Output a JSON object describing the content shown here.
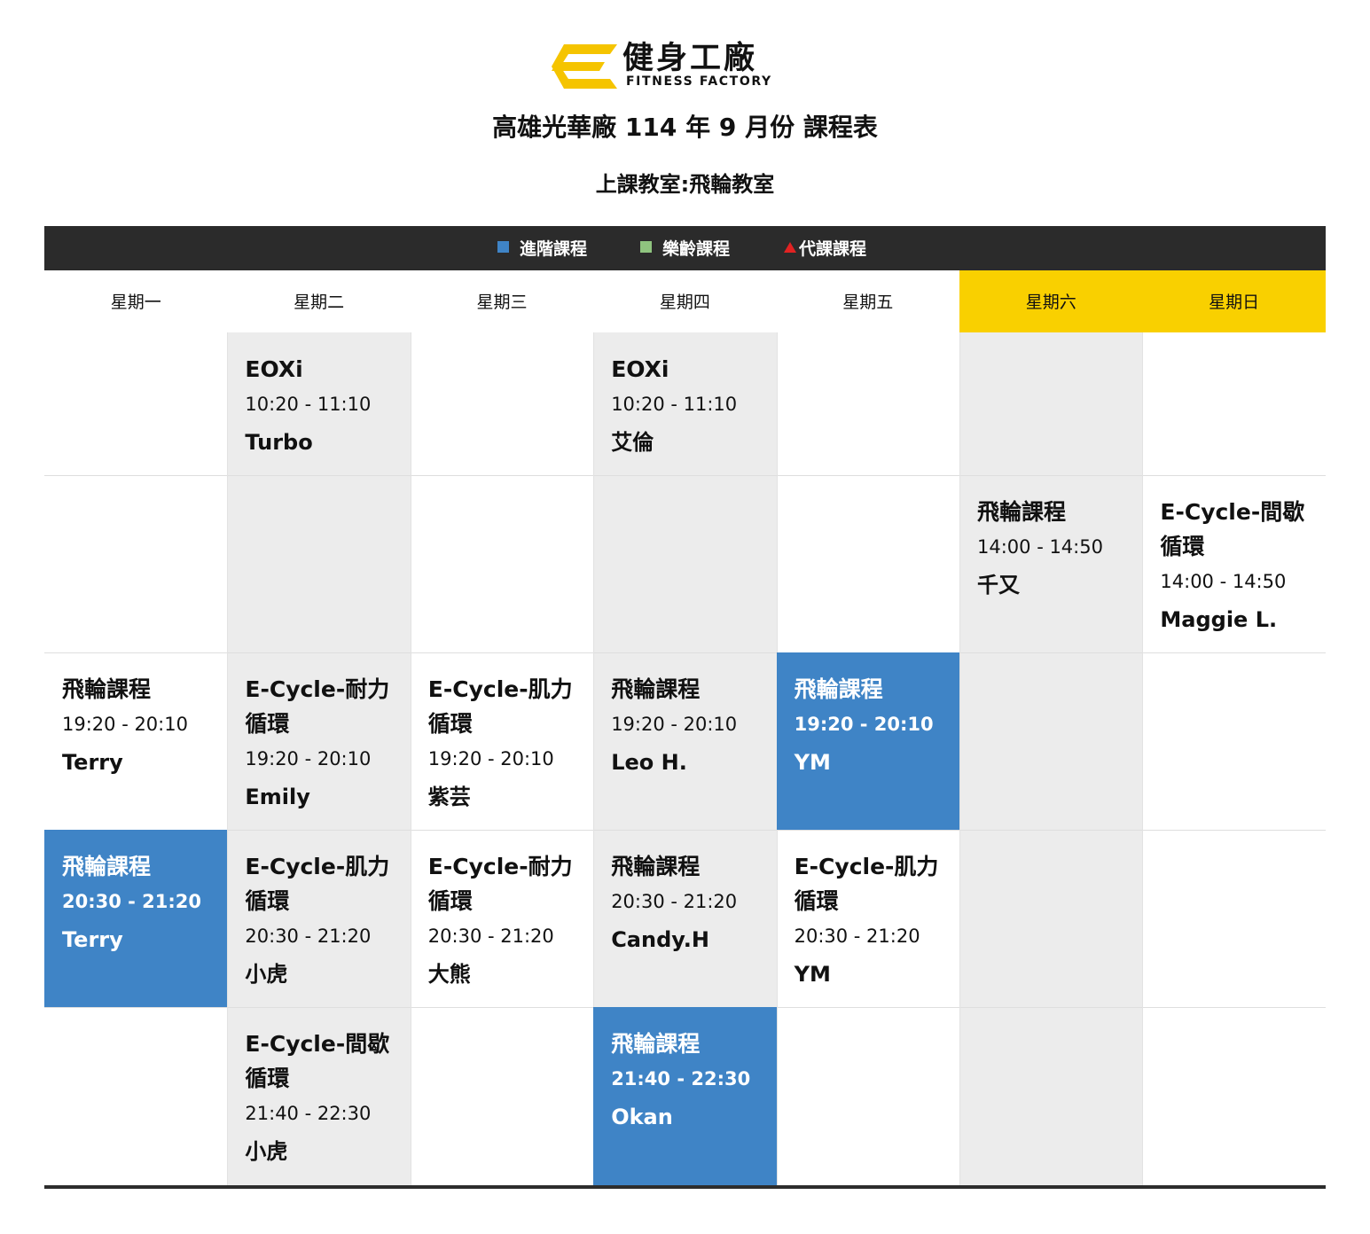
{
  "brand": {
    "name_cn": "健身工廠",
    "name_en": "FITNESS FACTORY",
    "logo_color": "#f5c400"
  },
  "title": "高雄光華廠 114 年 9 月份 課程表",
  "subtitle": "上課教室:飛輪教室",
  "legend": [
    {
      "label": "進階課程",
      "color": "#3f84c6",
      "marker": "square"
    },
    {
      "label": "樂齡課程",
      "color": "#8fc47f",
      "marker": "square"
    },
    {
      "label": "代課課程",
      "color": "#e12222",
      "marker": "triangle"
    }
  ],
  "days": [
    "星期一",
    "星期二",
    "星期三",
    "星期四",
    "星期五",
    "星期六",
    "星期日"
  ],
  "colors": {
    "header_bar": "#2b2b2b",
    "weekend_header": "#f9d000",
    "advanced": "#3f84c6",
    "grey_column": "#ececec"
  },
  "rows": [
    [
      null,
      {
        "name": "EOXi",
        "time": "10:20 - 11:10",
        "coach": "Turbo"
      },
      null,
      {
        "name": "EOXi",
        "time": "10:20 - 11:10",
        "coach": "艾倫"
      },
      null,
      null,
      null
    ],
    [
      null,
      null,
      null,
      null,
      null,
      {
        "name": "飛輪課程",
        "time": "14:00 - 14:50",
        "coach": "千又"
      },
      {
        "name": "E-Cycle-間歇循環",
        "time": "14:00 - 14:50",
        "coach": "Maggie L."
      }
    ],
    [
      {
        "name": "飛輪課程",
        "time": "19:20 - 20:10",
        "coach": "Terry"
      },
      {
        "name": "E-Cycle-耐力循環",
        "time": "19:20 - 20:10",
        "coach": "Emily"
      },
      {
        "name": "E-Cycle-肌力循環",
        "time": "19:20 - 20:10",
        "coach": "紫芸"
      },
      {
        "name": "飛輪課程",
        "time": "19:20 - 20:10",
        "coach": "Leo H."
      },
      {
        "name": "飛輪課程",
        "time": "19:20 - 20:10",
        "coach": "YM",
        "type": "advanced"
      },
      null,
      null
    ],
    [
      {
        "name": "飛輪課程",
        "time": "20:30 - 21:20",
        "coach": "Terry",
        "type": "advanced"
      },
      {
        "name": "E-Cycle-肌力循環",
        "time": "20:30 - 21:20",
        "coach": "小虎"
      },
      {
        "name": "E-Cycle-耐力循環",
        "time": "20:30 - 21:20",
        "coach": "大熊"
      },
      {
        "name": "飛輪課程",
        "time": "20:30 - 21:20",
        "coach": "Candy.H"
      },
      {
        "name": "E-Cycle-肌力循環",
        "time": "20:30 - 21:20",
        "coach": "YM"
      },
      null,
      null
    ],
    [
      null,
      {
        "name": "E-Cycle-間歇循環",
        "time": "21:40 - 22:30",
        "coach": "小虎"
      },
      null,
      {
        "name": "飛輪課程",
        "time": "21:40 - 22:30",
        "coach": "Okan",
        "type": "advanced"
      },
      null,
      null,
      null
    ]
  ]
}
